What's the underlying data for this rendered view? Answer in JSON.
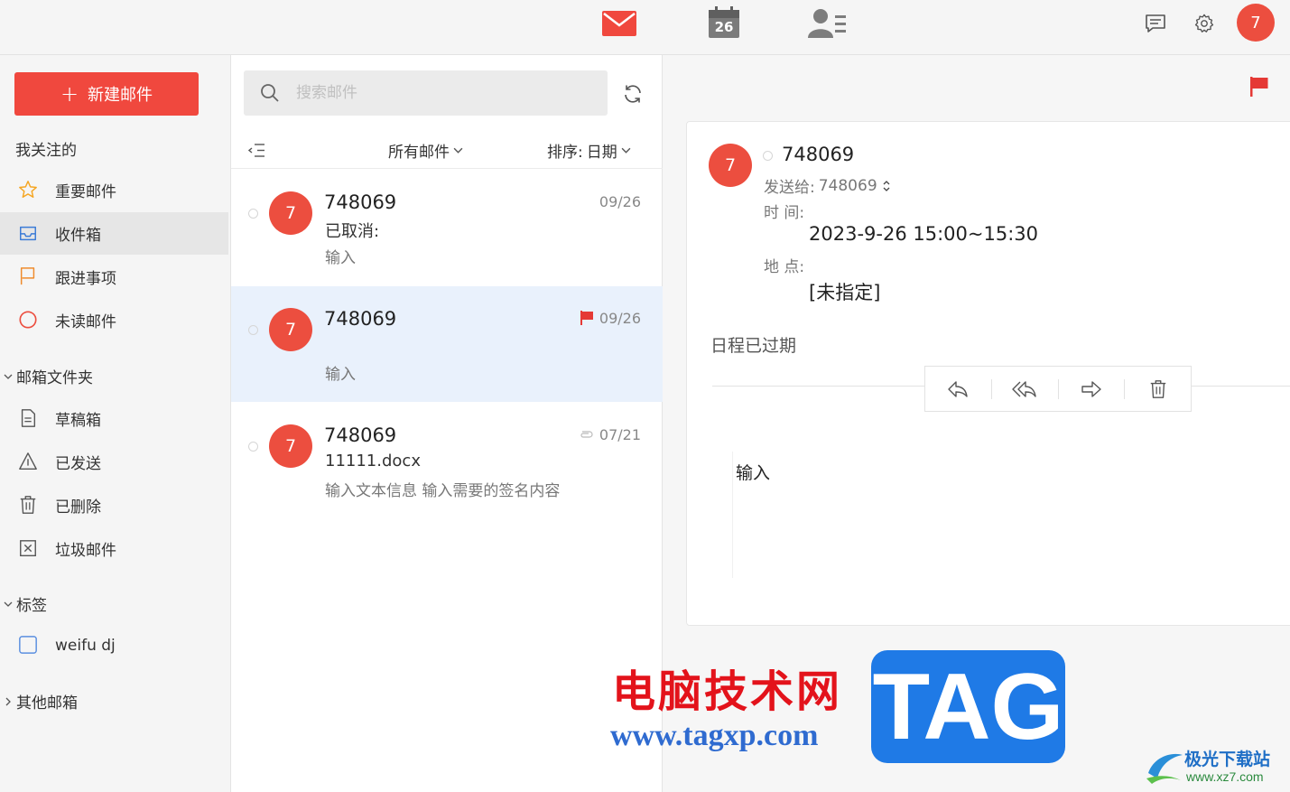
{
  "topbar": {
    "tabs": [
      {
        "icon": "mail-icon",
        "label": "mail",
        "active": true
      },
      {
        "icon": "calendar-icon",
        "label": "26"
      },
      {
        "icon": "contacts-icon",
        "label": "contacts"
      }
    ],
    "avatar_initial": "7",
    "accent_color": "#f0483e"
  },
  "sidebar": {
    "new_mail_label": "新建邮件",
    "followed_title": "我关注的",
    "followed_items": [
      {
        "icon": "star-icon",
        "label": "重要邮件"
      },
      {
        "icon": "inbox-icon",
        "label": "收件箱",
        "active": true
      },
      {
        "icon": "flag-outline-icon",
        "label": "跟进事项"
      },
      {
        "icon": "unread-circle-icon",
        "label": "未读邮件"
      }
    ],
    "folders_title": "邮箱文件夹",
    "folders": [
      {
        "icon": "draft-icon",
        "label": "草稿箱"
      },
      {
        "icon": "sent-icon",
        "label": "已发送"
      },
      {
        "icon": "trash-icon",
        "label": "已删除"
      },
      {
        "icon": "spam-icon",
        "label": "垃圾邮件"
      }
    ],
    "tags_title": "标签",
    "tags": [
      {
        "icon": "tag-checkbox-icon",
        "label": "weifu dj"
      }
    ],
    "other_title": "其他邮箱"
  },
  "list": {
    "search_placeholder": "搜索邮件",
    "filter_label": "所有邮件",
    "sort_label": "排序:",
    "sort_value": "日期",
    "items": [
      {
        "avatar": "7",
        "sender": "748069",
        "subject": "已取消:",
        "preview": "输入",
        "date": "09/26",
        "flag": false,
        "attachment": false
      },
      {
        "avatar": "7",
        "sender": "748069",
        "subject": "",
        "preview": "输入",
        "date": "09/26",
        "flag": true,
        "attachment": false,
        "selected": true
      },
      {
        "avatar": "7",
        "sender": "748069",
        "subject": "11111.docx",
        "preview": "输入文本信息 输入需要的签名内容",
        "date": "07/21",
        "flag": false,
        "attachment": true
      }
    ]
  },
  "reader": {
    "avatar": "7",
    "sender": "748069",
    "to_label": "发送给:",
    "to_value": "748069",
    "time_label": "时 间:",
    "time_value": "2023-9-26 15:00~15:30",
    "place_label": "地 点:",
    "place_value": "[未指定]",
    "status": "日程已过期",
    "body": "输入",
    "actions": [
      "reply-icon",
      "reply-all-icon",
      "forward-icon",
      "delete-icon"
    ]
  },
  "watermark": {
    "site_name": "电脑技术网",
    "site_url": "www.tagxp.com",
    "tag_text": "TAG",
    "corner_name": "极光下载站",
    "corner_url": "www.xz7.com"
  }
}
